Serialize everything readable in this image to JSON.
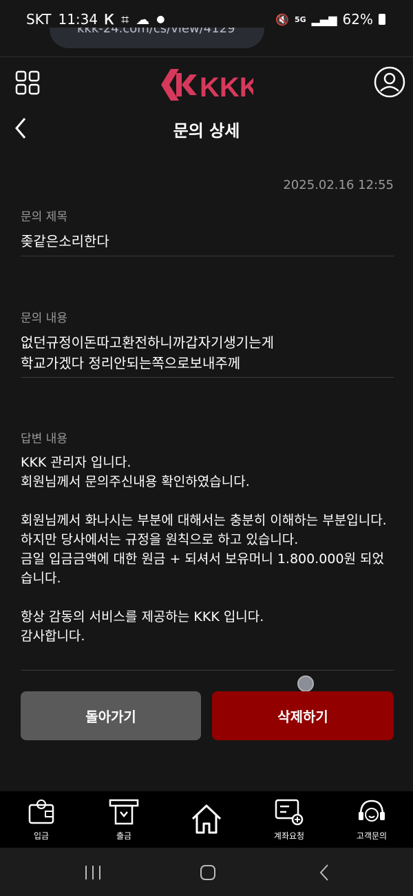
{
  "status": {
    "carrier": "SKT",
    "time": "11:34",
    "battery": "62%",
    "network": "5G"
  },
  "browser": {
    "url_fragment": "kkk-24.com/cs/view/4129"
  },
  "header": {
    "brand": "KKK"
  },
  "page": {
    "title": "문의 상세",
    "date": "2025.02.16 12:55"
  },
  "inquiry": {
    "subject_label": "문의 제목",
    "subject": "좆같은소리한다",
    "content_label": "문의 내용",
    "content": "없던규정이돈따고환전하니까갑자기생기는게\n학교가겠다 정리안되는쪽으로보내주께",
    "answer_label": "답변 내용",
    "answer": "KKK 관리자 입니다.\n회원님께서 문의주신내용 확인하였습니다.\n\n회원님께서 화나시는 부분에 대해서는 충분히 이해하는 부분입니다.\n하지만 당사에서는 규정을 원칙으로 하고 있습니다.\n금일 입금금액에 대한 원금 + 되셔서 보유머니 1.800.000원 되었습니다.\n\n항상 감동의 서비스를 제공하는 KKK 입니다.\n감사합니다."
  },
  "buttons": {
    "back": "돌아가기",
    "delete": "삭제하기"
  },
  "tabs": [
    {
      "label": "입금",
      "icon": "wallet-icon"
    },
    {
      "label": "출금",
      "icon": "atm-icon"
    },
    {
      "label": "",
      "icon": "home-icon"
    },
    {
      "label": "계좌요청",
      "icon": "account-request-icon"
    },
    {
      "label": "고객문의",
      "icon": "headset-icon"
    }
  ],
  "colors": {
    "background": "#161616",
    "delete_button": "#920000",
    "back_button": "#5a5a5a",
    "brand": "#d6395b"
  }
}
